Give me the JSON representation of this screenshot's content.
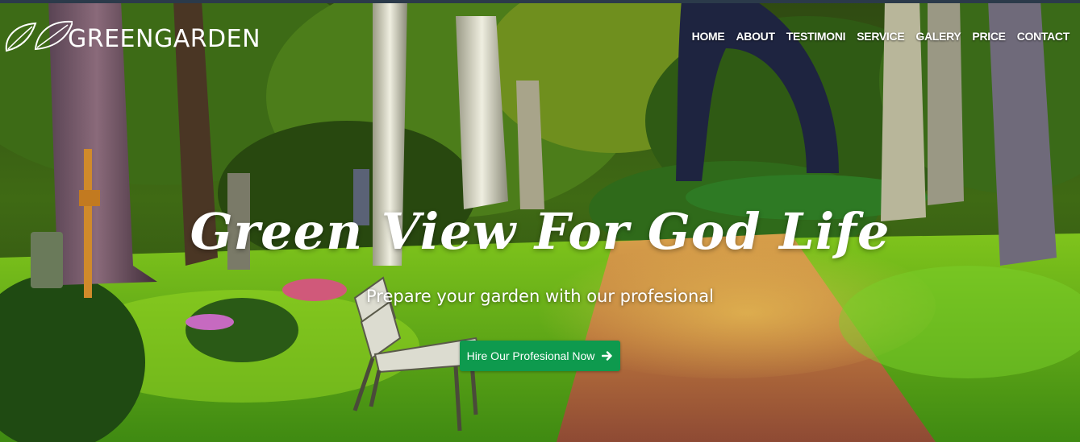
{
  "brand": {
    "name": "GREENGARDEN",
    "logo_icon": "leaf-logo-icon"
  },
  "nav": {
    "items": [
      {
        "label": "HOME"
      },
      {
        "label": "ABOUT"
      },
      {
        "label": "TESTIMONI"
      },
      {
        "label": "SERVICE"
      },
      {
        "label": "GALERY"
      },
      {
        "label": "PRICE"
      },
      {
        "label": "CONTACT"
      }
    ]
  },
  "hero": {
    "title": "Green View For God Life",
    "subtitle": "Prepare your garden with our profesional",
    "cta_label": "Hire Our Profesional Now",
    "cta_icon": "arrow-right-icon"
  },
  "colors": {
    "accent": "#0e9a4e",
    "text": "#ffffff",
    "top_strip": "#2b3a4a"
  }
}
